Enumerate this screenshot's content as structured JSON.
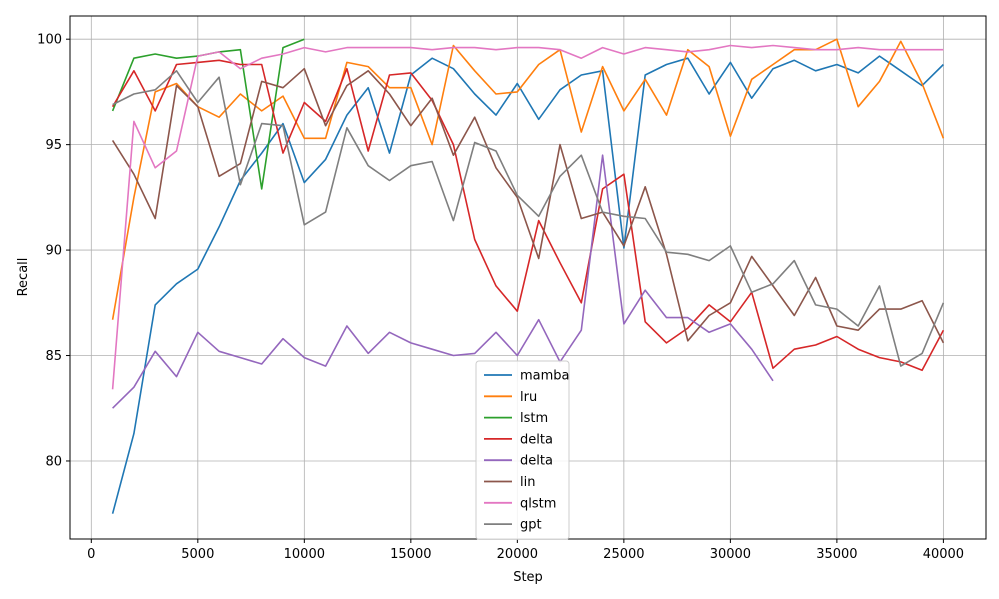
{
  "chart_data": {
    "type": "line",
    "xlabel": "Step",
    "ylabel": "Recall",
    "xlim": [
      -1000,
      42000
    ],
    "ylim": [
      76.3,
      101.1
    ],
    "xticks": [
      0,
      5000,
      10000,
      15000,
      20000,
      25000,
      30000,
      35000,
      40000
    ],
    "yticks": [
      80,
      85,
      90,
      95,
      100
    ],
    "grid": true,
    "legend_position": "bottom-center",
    "series": [
      {
        "name": "mamba",
        "color": "#1f77b4",
        "x": [
          1000,
          2000,
          3000,
          4000,
          5000,
          6000,
          7000,
          8000,
          9000,
          10000,
          11000,
          12000,
          13000,
          14000,
          15000,
          16000,
          17000,
          18000,
          19000,
          20000,
          21000,
          22000,
          23000,
          24000,
          25000,
          26000,
          27000,
          28000,
          29000,
          30000,
          31000,
          32000,
          33000,
          34000,
          35000,
          36000,
          37000,
          38000,
          39000,
          40000
        ],
        "y": [
          77.5,
          81.3,
          87.4,
          88.4,
          89.1,
          91.1,
          93.3,
          94.6,
          96.0,
          93.2,
          94.3,
          96.4,
          97.7,
          94.6,
          98.3,
          99.1,
          98.6,
          97.4,
          96.4,
          97.9,
          96.2,
          97.6,
          98.3,
          98.5,
          90.1,
          98.3,
          98.8,
          99.1,
          97.4,
          98.9,
          97.2,
          98.6,
          99.0,
          98.5,
          98.8,
          98.4,
          99.2,
          98.5,
          97.8,
          98.8
        ]
      },
      {
        "name": "lru",
        "color": "#ff7f0e",
        "x": [
          1000,
          2000,
          3000,
          4000,
          5000,
          6000,
          7000,
          8000,
          9000,
          10000,
          11000,
          12000,
          13000,
          14000,
          15000,
          16000,
          17000,
          18000,
          19000,
          20000,
          21000,
          22000,
          23000,
          24000,
          25000,
          26000,
          27000,
          28000,
          29000,
          30000,
          31000,
          32000,
          33000,
          34000,
          35000,
          36000,
          37000,
          38000,
          39000,
          40000
        ],
        "y": [
          86.7,
          92.5,
          97.5,
          97.9,
          96.8,
          96.3,
          97.4,
          96.6,
          97.3,
          95.3,
          95.3,
          98.9,
          98.7,
          97.7,
          97.7,
          95.0,
          99.7,
          98.5,
          97.4,
          97.5,
          98.8,
          99.5,
          95.6,
          98.7,
          96.6,
          98.1,
          96.4,
          99.5,
          98.7,
          95.4,
          98.1,
          98.8,
          99.5,
          99.5,
          100.0,
          96.8,
          98.0,
          99.9,
          97.9,
          95.3
        ]
      },
      {
        "name": "lstm",
        "color": "#2ca02c",
        "x": [
          1000,
          2000,
          3000,
          4000,
          5000,
          6000,
          7000,
          8000,
          9000,
          10000
        ],
        "y": [
          96.6,
          99.1,
          99.3,
          99.1,
          99.2,
          99.4,
          99.5,
          92.9,
          99.6,
          100.0
        ]
      },
      {
        "name": "delta",
        "color": "#d62728",
        "x": [
          1000,
          2000,
          3000,
          4000,
          5000,
          6000,
          7000,
          8000,
          9000,
          10000,
          11000,
          12000,
          13000,
          14000,
          15000,
          16000,
          17000,
          18000,
          19000,
          20000,
          21000,
          22000,
          23000,
          24000,
          25000,
          26000,
          27000,
          28000,
          29000,
          30000,
          31000,
          32000,
          33000,
          34000,
          35000,
          36000,
          37000,
          38000,
          39000,
          40000
        ],
        "y": [
          96.8,
          98.5,
          96.6,
          98.8,
          98.9,
          99.0,
          98.8,
          98.8,
          94.6,
          97.0,
          96.1,
          98.6,
          94.7,
          98.3,
          98.4,
          97.1,
          95.0,
          90.5,
          88.3,
          87.1,
          91.4,
          89.4,
          87.5,
          92.9,
          93.6,
          86.6,
          85.6,
          86.3,
          87.4,
          86.6,
          88.0,
          84.4,
          85.3,
          85.5,
          85.9,
          85.3,
          84.9,
          84.7,
          84.3,
          86.2
        ]
      },
      {
        "name": "delta",
        "color": "#9467bd",
        "x": [
          1000,
          2000,
          3000,
          4000,
          5000,
          6000,
          7000,
          8000,
          9000,
          10000,
          11000,
          12000,
          13000,
          14000,
          15000,
          16000,
          17000,
          18000,
          19000,
          20000,
          21000,
          22000,
          23000,
          24000,
          25000,
          26000,
          27000,
          28000,
          29000,
          30000,
          31000,
          32000
        ],
        "y": [
          82.5,
          83.5,
          85.2,
          84.0,
          86.1,
          85.2,
          84.9,
          84.6,
          85.8,
          84.9,
          84.5,
          86.4,
          85.1,
          86.1,
          85.6,
          85.3,
          85.0,
          85.1,
          86.1,
          85.0,
          86.7,
          84.7,
          86.2,
          94.5,
          86.5,
          88.1,
          86.8,
          86.8,
          86.1,
          86.5,
          85.3,
          83.8
        ]
      },
      {
        "name": "lin",
        "color": "#8c564b",
        "x": [
          1000,
          2000,
          3000,
          4000,
          5000,
          6000,
          7000,
          8000,
          9000,
          10000,
          11000,
          12000,
          13000,
          14000,
          15000,
          16000,
          17000,
          18000,
          19000,
          20000,
          21000,
          22000,
          23000,
          24000,
          25000,
          26000,
          27000,
          28000,
          29000,
          30000,
          31000,
          32000,
          33000,
          34000,
          35000,
          36000,
          37000,
          38000,
          39000,
          40000
        ],
        "y": [
          95.2,
          93.6,
          91.5,
          97.8,
          96.8,
          93.5,
          94.1,
          98.0,
          97.7,
          98.6,
          95.9,
          97.8,
          98.5,
          97.4,
          95.9,
          97.2,
          94.5,
          96.3,
          93.9,
          92.5,
          89.6,
          95.0,
          91.5,
          91.8,
          90.2,
          93.0,
          89.8,
          85.7,
          86.9,
          87.5,
          89.7,
          88.3,
          86.9,
          88.7,
          86.4,
          86.2,
          87.2,
          87.2,
          87.6,
          85.6
        ]
      },
      {
        "name": "qlstm",
        "color": "#e377c2",
        "x": [
          1000,
          2000,
          3000,
          4000,
          5000,
          6000,
          7000,
          8000,
          9000,
          10000,
          11000,
          12000,
          13000,
          14000,
          15000,
          16000,
          17000,
          18000,
          19000,
          20000,
          21000,
          22000,
          23000,
          24000,
          25000,
          26000,
          27000,
          28000,
          29000,
          30000,
          31000,
          32000,
          33000,
          34000,
          35000,
          36000,
          37000,
          38000,
          39000,
          40000
        ],
        "y": [
          83.4,
          96.1,
          93.9,
          94.7,
          99.2,
          99.4,
          98.6,
          99.1,
          99.3,
          99.6,
          99.4,
          99.6,
          99.6,
          99.6,
          99.6,
          99.5,
          99.6,
          99.6,
          99.5,
          99.6,
          99.6,
          99.5,
          99.1,
          99.6,
          99.3,
          99.6,
          99.5,
          99.4,
          99.5,
          99.7,
          99.6,
          99.7,
          99.6,
          99.5,
          99.5,
          99.6,
          99.5,
          99.5,
          99.5,
          99.5
        ]
      },
      {
        "name": "gpt",
        "color": "#7f7f7f",
        "x": [
          1000,
          2000,
          3000,
          4000,
          5000,
          6000,
          7000,
          8000,
          9000,
          10000,
          11000,
          12000,
          13000,
          14000,
          15000,
          16000,
          17000,
          18000,
          19000,
          20000,
          21000,
          22000,
          23000,
          24000,
          25000,
          26000,
          27000,
          28000,
          29000,
          30000,
          31000,
          32000,
          33000,
          34000,
          35000,
          36000,
          37000,
          38000,
          39000,
          40000
        ],
        "y": [
          96.9,
          97.4,
          97.6,
          98.5,
          97.0,
          98.2,
          93.1,
          96.0,
          95.9,
          91.2,
          91.8,
          95.8,
          94.0,
          93.3,
          94.0,
          94.2,
          91.4,
          95.1,
          94.7,
          92.6,
          91.6,
          93.5,
          94.5,
          91.8,
          91.6,
          91.5,
          89.9,
          89.8,
          89.5,
          90.2,
          88.0,
          88.4,
          89.5,
          87.4,
          87.2,
          86.4,
          88.3,
          84.5,
          85.1,
          87.5
        ]
      }
    ]
  }
}
